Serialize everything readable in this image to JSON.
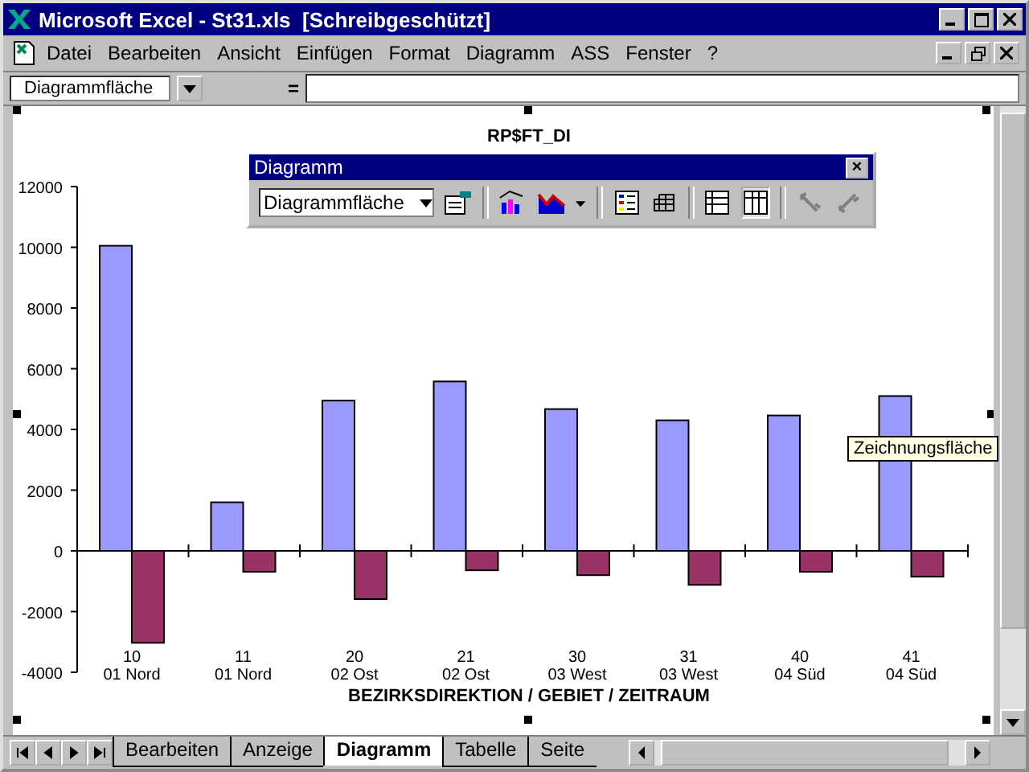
{
  "window": {
    "title": "Microsoft Excel - St31.xls  [Schreibgeschützt]"
  },
  "menu": [
    "Datei",
    "Bearbeiten",
    "Ansicht",
    "Einfügen",
    "Format",
    "Diagramm",
    "ASS",
    "Fenster",
    "?"
  ],
  "formula_bar": {
    "name_box": "Diagrammfläche",
    "equals": "="
  },
  "chart_data": {
    "type": "bar",
    "title": "RP$FT_DI",
    "xlabel": "BEZIRKSDIREKTION / GEBIET / ZEITRAUM",
    "categories": [
      "10\n01 Nord",
      "11\n01 Nord",
      "20\n02 Ost",
      "21\n02 Ost",
      "30\n03 West",
      "31\n03 West",
      "40\n04 Süd",
      "41\n04 Süd"
    ],
    "series": [
      {
        "color": "#9999ff",
        "values": [
          10050,
          1600,
          4950,
          5580,
          4670,
          4300,
          4460,
          5100
        ]
      },
      {
        "color": "#993366",
        "values": [
          -3030,
          -690,
          -1590,
          -640,
          -800,
          -1120,
          -690,
          -850
        ]
      }
    ],
    "ylim": [
      -4000,
      12000
    ],
    "yticks": [
      -4000,
      -2000,
      0,
      2000,
      4000,
      6000,
      8000,
      10000,
      12000
    ]
  },
  "chart_toolbar": {
    "title": "Diagramm",
    "object_select": "Diagrammfläche",
    "close": "×"
  },
  "tooltip": "Zeichnungsfläche",
  "sheet_tabs": [
    {
      "label": "Bearbeiten",
      "selected": false
    },
    {
      "label": "Anzeige",
      "selected": false
    },
    {
      "label": "Diagramm",
      "selected": true
    },
    {
      "label": "Tabelle",
      "selected": false
    },
    {
      "label": "Seite",
      "selected": false
    }
  ]
}
